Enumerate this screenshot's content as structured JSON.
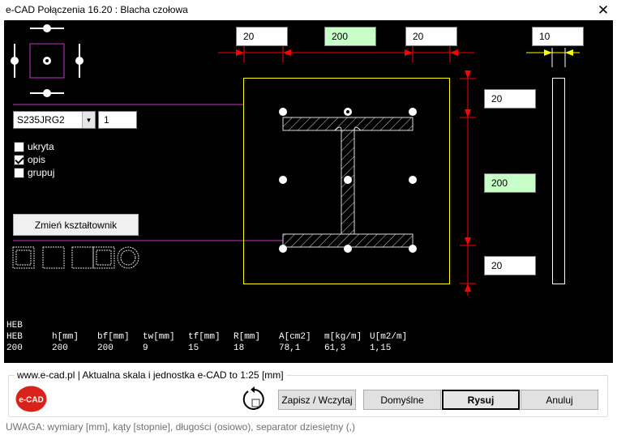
{
  "window": {
    "title": "e-CAD Połączenia 16.20 : Blacha czołowa",
    "close_symbol": "✕"
  },
  "dimensions": {
    "top": [
      "20",
      "200",
      "20"
    ],
    "thickness": "10",
    "right": [
      "20",
      "200",
      "20"
    ]
  },
  "settings": {
    "material": "S235JRG2",
    "quantity": "1",
    "checkboxes": [
      {
        "label": "ukryta",
        "checked": false
      },
      {
        "label": "opis",
        "checked": true
      },
      {
        "label": "grupuj",
        "checked": false
      }
    ],
    "change_profile_label": "Zmień kształtownik"
  },
  "section_table": {
    "name": "HEB",
    "headers": [
      "HEB",
      "h[mm]",
      "bf[mm]",
      "tw[mm]",
      "tf[mm]",
      "R[mm]",
      "A[cm2]",
      "m[kg/m]",
      "U[m2/m]"
    ],
    "values": [
      "200",
      "200",
      "200",
      "9",
      "15",
      "18",
      "78,1",
      "61,3",
      "1,15"
    ]
  },
  "footer": {
    "caption": "www.e-cad.pl | Aktualna skala i jednostka e-CAD to 1:25 [mm]",
    "logo_text": "e-CAD",
    "buttons": {
      "save_load": "Zapisz / Wczytaj",
      "defaults": "Domyślne",
      "draw": "Rysuj",
      "cancel": "Anuluj"
    },
    "warning": "UWAGA: wymiary [mm], kąty [stopnie], długości (osiowo), separator dziesiętny (,)"
  },
  "colors": {
    "background": "#000000",
    "plate_outline": "#ffff00",
    "dimension_lines": "#ff0000",
    "guide_lines": "#cc33cc",
    "highlight_input": "#c8ffc8"
  }
}
